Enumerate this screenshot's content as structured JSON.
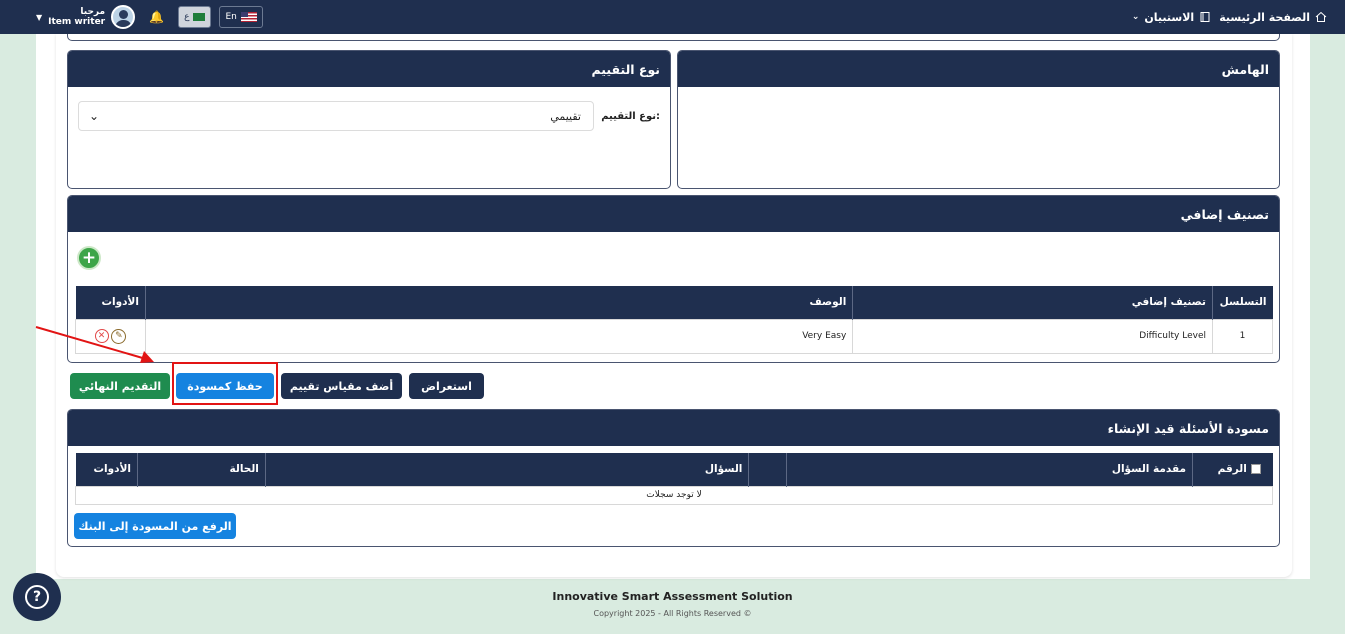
{
  "topbar": {
    "nav": [
      {
        "label": "الصفحة الرئيسية",
        "icon": "home-icon"
      },
      {
        "label": "الاستبيان",
        "icon": "book-icon"
      }
    ],
    "user_greeting": "مرحبا",
    "user_name": "Item writer",
    "lang_ar": "ع",
    "lang_en": "En"
  },
  "margin_card": {
    "title": "الهامش"
  },
  "assessment_type": {
    "title": "نوع التقييم",
    "field_label": "نوع التقييم:",
    "selected": "تقييمي"
  },
  "classification": {
    "title": "تصنيف إضافي",
    "columns": [
      "التسلسل",
      "تصنيف إضافي",
      "الوصف",
      "الأدوات"
    ],
    "rows": [
      {
        "seq": "1",
        "classification": "Difficulty Level",
        "description": "Very Easy"
      }
    ]
  },
  "actions": {
    "preview": "استعراض",
    "add_scale": "أضف مقياس تقييم",
    "save_draft": "حفظ كمسودة",
    "final_submit": "التقديم النهائي"
  },
  "drafts": {
    "title": "مسودة الأسئلة قيد الإنشاء",
    "columns": [
      "الرقم",
      "مقدمة السؤال",
      "السؤال",
      "الحالة",
      "الأدوات"
    ],
    "empty": "لا توجد سجلات",
    "upload_button": "الرفع من المسودة إلى البنك"
  },
  "footer": {
    "title": "Innovative Smart Assessment Solution",
    "copyright": "Copyright 2025 - All Rights Reserved ©"
  },
  "colors": {
    "navy": "#1f2f4f",
    "blue": "#1583e0",
    "green": "#1f8c4f",
    "highlight": "#e21414"
  }
}
